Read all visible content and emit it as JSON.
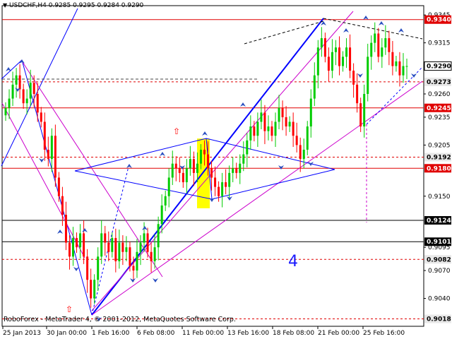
{
  "header": {
    "symbol_label": "USDCHF,H4",
    "ohlc_label": "0.9285 0.9295 0.9284 0.9290"
  },
  "footer": {
    "copyright": "RoboForex - MetaTrader 4, © 2001-2012, MetaQuotes Software Corp."
  },
  "annotation": {
    "wave_number": "4"
  },
  "colors": {
    "bull_candle": "#00cc00",
    "bear_candle": "#ff0000",
    "level_red": "#e00000",
    "level_black": "#000000",
    "trend_blue": "#0000ff",
    "channel_magenta": "#cc00cc",
    "highlight_yellow": "#ffff00"
  },
  "chart_data": {
    "type": "candlestick",
    "title": "USDCHF,H4",
    "ylim": [
      0.901,
      0.9355
    ],
    "y_ticks": [
      "0.9345",
      "0.9315",
      "0.9290",
      "0.9260",
      "0.9235",
      "0.9205",
      "0.9180",
      "0.9150",
      "0.9124",
      "0.9101",
      "0.9095",
      "0.9070",
      "0.9040",
      "0.9018"
    ],
    "x_ticks": [
      "25 Jan 2013",
      "30 Jan 00:00",
      "1 Feb 16:00",
      "6 Feb 08:00",
      "11 Feb 00:00",
      "13 Feb 16:00",
      "18 Feb 08:00",
      "21 Feb 00:00",
      "25 Feb 16:00"
    ],
    "price_tags": [
      {
        "value": "0.9340",
        "style": "red"
      },
      {
        "value": "0.9290",
        "style": "current"
      },
      {
        "value": "0.9273",
        "style": "dashed"
      },
      {
        "value": "0.9245",
        "style": "red"
      },
      {
        "value": "0.9192",
        "style": "dashed"
      },
      {
        "value": "0.9180",
        "style": "red"
      },
      {
        "value": "0.9124",
        "style": "black"
      },
      {
        "value": "0.9101",
        "style": "black"
      },
      {
        "value": "0.9082",
        "style": "dashed"
      },
      {
        "value": "0.9018",
        "style": "dashed"
      }
    ],
    "closes": [
      0.9245,
      0.9255,
      0.927,
      0.928,
      0.9265,
      0.925,
      0.9255,
      0.9272,
      0.926,
      0.924,
      0.923,
      0.92,
      0.919,
      0.9215,
      0.917,
      0.915,
      0.913,
      0.91,
      0.9085,
      0.9105,
      0.9095,
      0.911,
      0.9085,
      0.906,
      0.904,
      0.906,
      0.9085,
      0.911,
      0.91,
      0.909,
      0.9105,
      0.908,
      0.91,
      0.909,
      0.9095,
      0.9075,
      0.907,
      0.909,
      0.91,
      0.911,
      0.909,
      0.908,
      0.9095,
      0.912,
      0.914,
      0.915,
      0.917,
      0.9185,
      0.918,
      0.9175,
      0.9165,
      0.918,
      0.919,
      0.9175,
      0.9185,
      0.92,
      0.9195,
      0.918,
      0.917,
      0.916,
      0.915,
      0.9165,
      0.916,
      0.9175,
      0.918,
      0.9175,
      0.9185,
      0.9195,
      0.921,
      0.9225,
      0.9215,
      0.923,
      0.924,
      0.922,
      0.9225,
      0.9215,
      0.923,
      0.9245,
      0.9235,
      0.9225,
      0.923,
      0.9215,
      0.9205,
      0.919,
      0.92,
      0.9225,
      0.9255,
      0.928,
      0.931,
      0.932,
      0.93,
      0.9285,
      0.9305,
      0.931,
      0.929,
      0.93,
      0.931,
      0.9285,
      0.927,
      0.925,
      0.9225,
      0.926,
      0.93,
      0.9315,
      0.9325,
      0.93,
      0.931,
      0.932,
      0.9305,
      0.929,
      0.9295,
      0.928,
      0.929,
      0.929
    ],
    "annotations": [
      "4"
    ]
  }
}
